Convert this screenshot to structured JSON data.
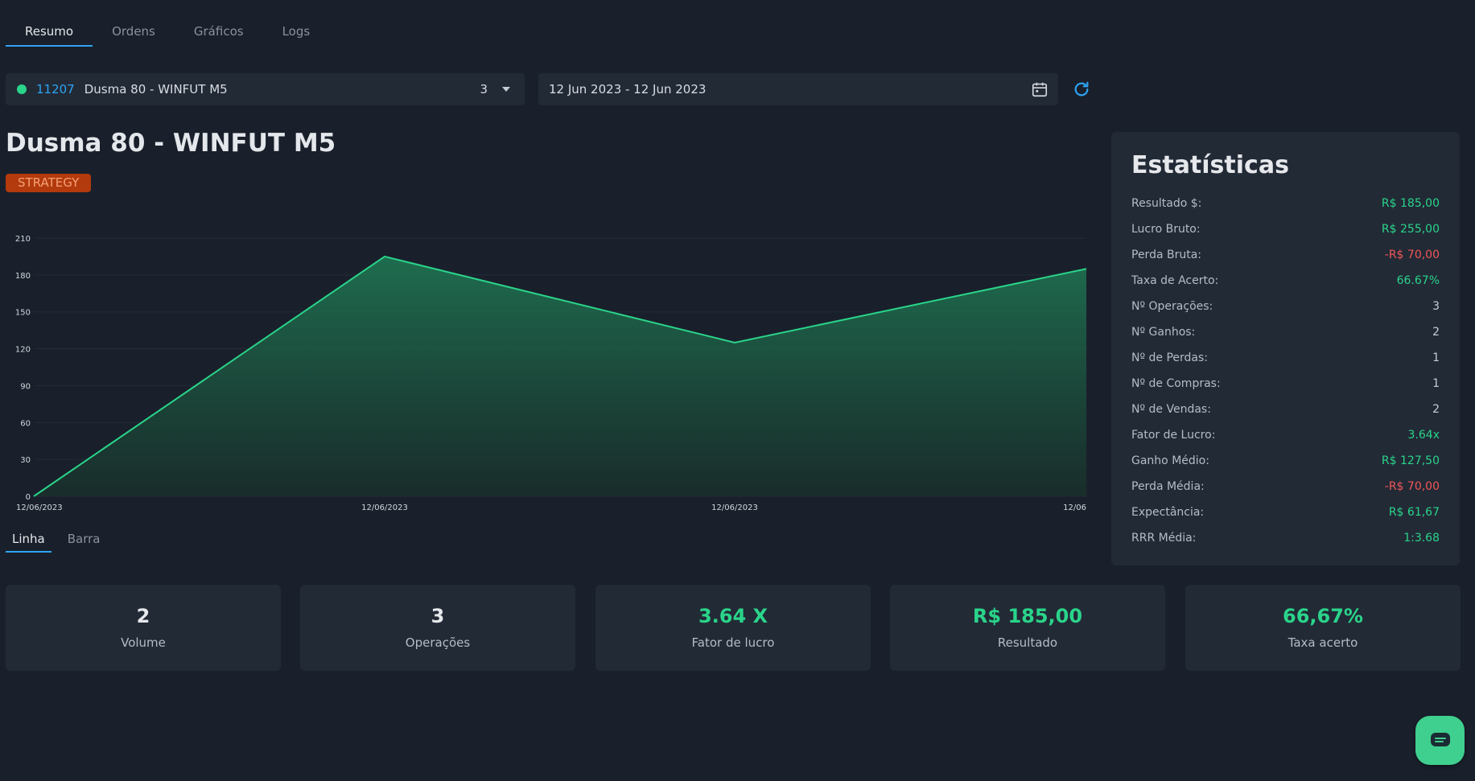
{
  "tabs": [
    "Resumo",
    "Ordens",
    "Gráficos",
    "Logs"
  ],
  "selector": {
    "id": "11207",
    "name": "Dusma 80 - WINFUT M5",
    "count": "3"
  },
  "daterange": {
    "text": "12 Jun 2023 - 12 Jun 2023"
  },
  "title": "Dusma 80 - WINFUT M5",
  "badge": "STRATEGY",
  "chart_data": {
    "type": "area",
    "x": [
      "12/06/2023",
      "12/06/2023",
      "12/06/2023",
      "12/06"
    ],
    "values": [
      0,
      195,
      125,
      185
    ],
    "yticks": [
      0,
      30,
      60,
      90,
      120,
      150,
      180,
      210
    ],
    "ylim": [
      0,
      210
    ],
    "color": "#2ad48a"
  },
  "chart_tabs": [
    "Linha",
    "Barra"
  ],
  "stats": {
    "title": "Estatísticas",
    "rows": [
      {
        "label": "Resultado $:",
        "value": "R$ 185,00",
        "tone": "green"
      },
      {
        "label": "Lucro Bruto:",
        "value": "R$ 255,00",
        "tone": "green"
      },
      {
        "label": "Perda Bruta:",
        "value": "-R$ 70,00",
        "tone": "red"
      },
      {
        "label": "Taxa de Acerto:",
        "value": "66.67%",
        "tone": "green"
      },
      {
        "label": "Nº Operações:",
        "value": "3",
        "tone": "plain"
      },
      {
        "label": "Nº Ganhos:",
        "value": "2",
        "tone": "plain"
      },
      {
        "label": "Nº de Perdas:",
        "value": "1",
        "tone": "plain"
      },
      {
        "label": "Nº de Compras:",
        "value": "1",
        "tone": "plain"
      },
      {
        "label": "Nº de Vendas:",
        "value": "2",
        "tone": "plain"
      },
      {
        "label": "Fator de Lucro:",
        "value": "3.64x",
        "tone": "green"
      },
      {
        "label": "Ganho Médio:",
        "value": "R$ 127,50",
        "tone": "green"
      },
      {
        "label": "Perda Média:",
        "value": "-R$ 70,00",
        "tone": "red"
      },
      {
        "label": "Expectância:",
        "value": "R$ 61,67",
        "tone": "green"
      },
      {
        "label": "RRR Média:",
        "value": "1:3.68",
        "tone": "green"
      }
    ]
  },
  "cards": [
    {
      "value": "2",
      "label": "Volume",
      "tone": "plain"
    },
    {
      "value": "3",
      "label": "Operações",
      "tone": "plain"
    },
    {
      "value": "3.64 X",
      "label": "Fator de lucro",
      "tone": "green"
    },
    {
      "value": "R$ 185,00",
      "label": "Resultado",
      "tone": "green"
    },
    {
      "value": "66,67%",
      "label": "Taxa acerto",
      "tone": "green"
    }
  ]
}
